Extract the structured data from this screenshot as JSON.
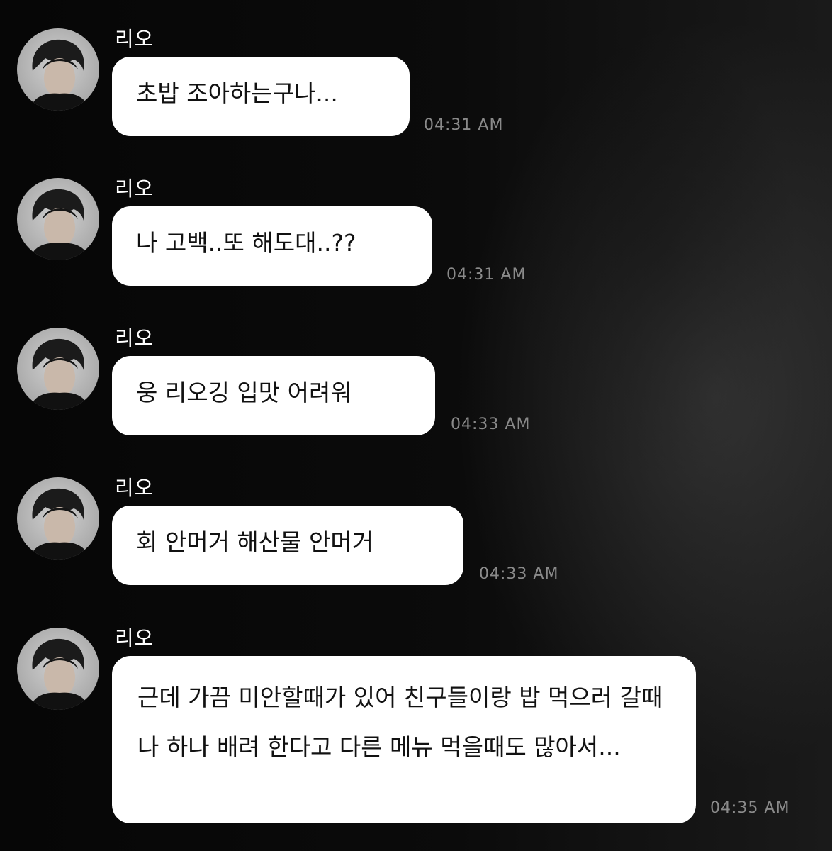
{
  "messages": [
    {
      "sender": "리오",
      "text": "초밥 조아하는구나...",
      "time": "04:31 AM"
    },
    {
      "sender": "리오",
      "text": "나 고백..또 해도대..??",
      "time": "04:31 AM"
    },
    {
      "sender": "리오",
      "text": "웅 리오깅 입맛 어려워",
      "time": "04:33 AM"
    },
    {
      "sender": "리오",
      "text": "회 안머거 해산물 안머거",
      "time": "04:33 AM"
    },
    {
      "sender": "리오",
      "text": "근데 가끔 미안할때가 있어 친구들이랑 밥 먹으러 갈때 나 하나 배려 한다고 다른 메뉴 먹을때도 많아서...",
      "time": "04:35 AM"
    }
  ]
}
